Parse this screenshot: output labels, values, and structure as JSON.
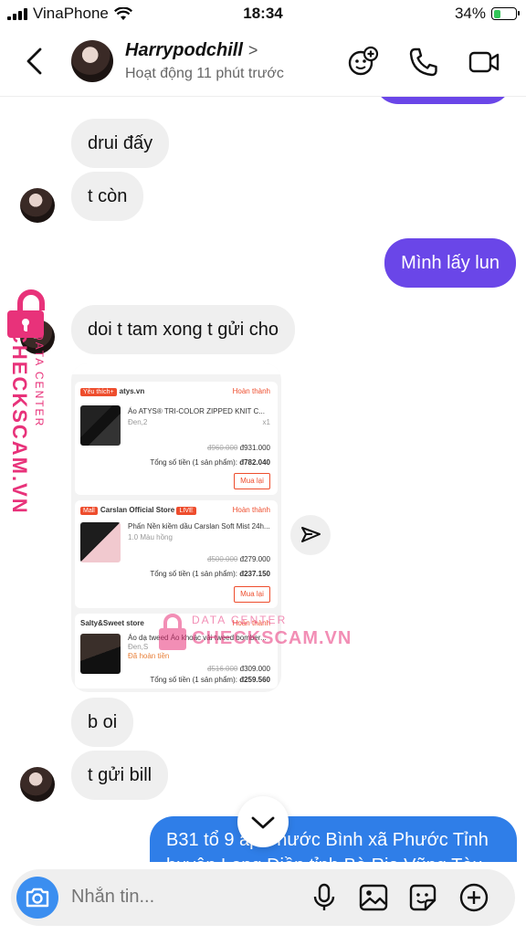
{
  "status_bar": {
    "carrier": "VinaPhone",
    "time": "18:34",
    "battery": "34%",
    "battery_level": 0.34
  },
  "header": {
    "name": "Harrypodchill",
    "chevron": ">",
    "activity": "Hoạt động 11 phút trước",
    "icons": [
      "back-chevron-icon",
      "add-friend-icon",
      "phone-icon",
      "video-icon"
    ]
  },
  "messages": [
    {
      "side": "in",
      "text": "drui đấy"
    },
    {
      "side": "in",
      "text": "t còn"
    },
    {
      "side": "out",
      "text": "Mình lấy lun"
    },
    {
      "side": "in",
      "text": "doi t tam xong t gửi cho"
    },
    {
      "side": "in",
      "text": "b oi"
    },
    {
      "side": "in",
      "text": "t gửi bill"
    },
    {
      "side": "out",
      "text": "B31 tổ 9 ấp Phước Bình xã Phước Tỉnh huyện Long Điền tỉnh Bà Rịa Vũng Tàu"
    }
  ],
  "orders": [
    {
      "tag": "Yêu thích+",
      "shop": "atys.vn",
      "status": "Hoàn thành",
      "product": "Áo ATYS® TRI-COLOR ZIPPED KNIT C...",
      "variant": "Đen,2",
      "qty": "x1",
      "old_price": "đ960.000",
      "price": "đ931.000",
      "total_label": "Tổng số tiền (1 sản phẩm):",
      "total": "đ782.040",
      "button": "Mua lại"
    },
    {
      "tag": "Mall",
      "shop": "Carslan Official Store",
      "badge": "LIVE",
      "status": "Hoàn thành",
      "product": "Phấn Nền kiềm dầu Carslan Soft Mist 24h...",
      "variant": "1.0 Màu hồng",
      "qty": "x1",
      "old_price": "đ500.000",
      "price": "đ279.000",
      "total_label": "Tổng số tiền (1 sản phẩm):",
      "total": "đ237.150",
      "button": "Mua lại"
    },
    {
      "shop": "Salty&Sweet store",
      "status": "Hoàn thành",
      "product": "Áo dạ tweed Áo khoác vải tweed bomber...",
      "variant": "Đen,S",
      "refund": "Đã hoàn tiền",
      "qty": "x1",
      "old_price": "đ516.000",
      "price": "đ309.000",
      "total_label": "Tổng số tiền (1 sản phẩm):",
      "total": "đ259.560"
    }
  ],
  "watermark": {
    "small": "DATA CENTER",
    "big": "CHECKSCAM.VN"
  },
  "composer": {
    "placeholder": "Nhắn tin..."
  },
  "colors": {
    "out_bubble": "#6a46e8",
    "link_bubble": "#2f7ee8",
    "in_bubble": "#efefef",
    "shopee": "#ee4d2d",
    "watermark": "#e8327a"
  }
}
